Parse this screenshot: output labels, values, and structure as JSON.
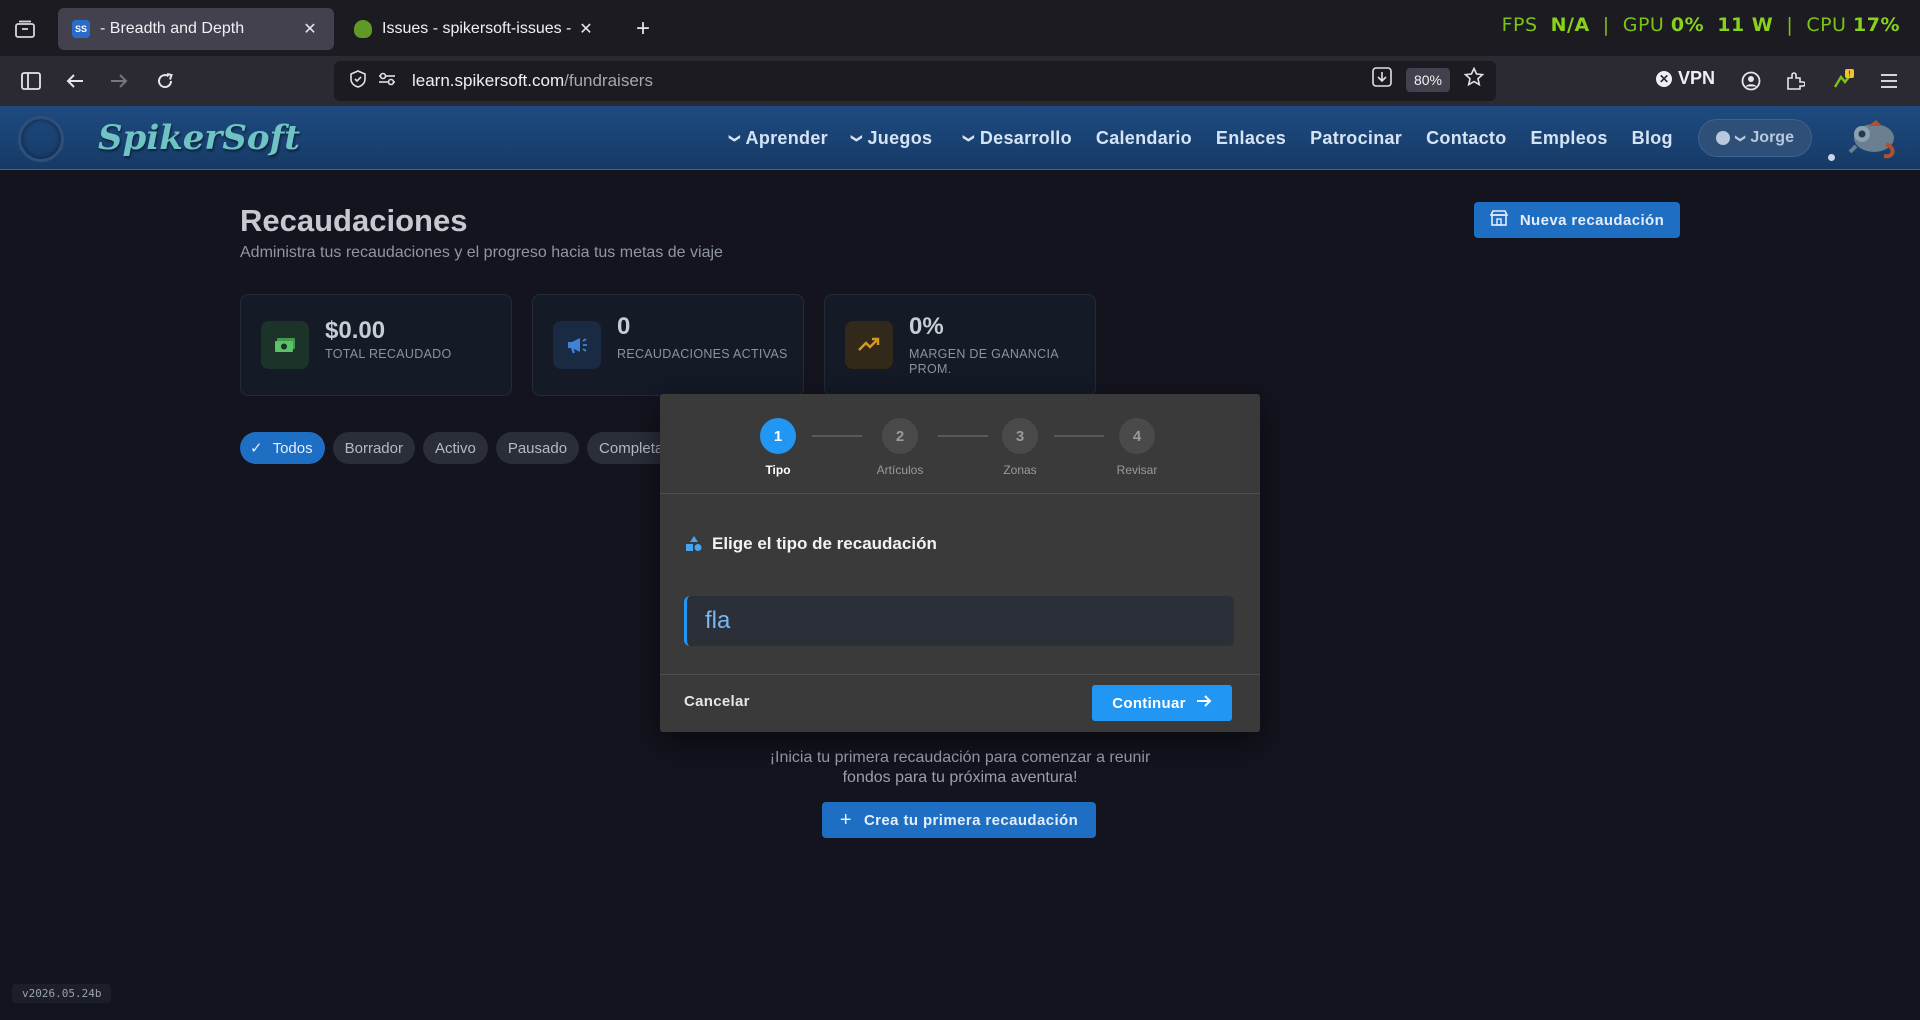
{
  "browser": {
    "tabs": [
      {
        "title": "- Breadth and Depth",
        "active": true
      },
      {
        "title": "Issues - spikersoft-issues - Gitea",
        "active": false
      }
    ],
    "url_host": "learn.spikersoft.com",
    "url_path": "/fundraisers",
    "zoom": "80%",
    "vpn_label": "VPN",
    "perf_overlay": {
      "fps_label": "FPS",
      "fps_value": "N/A",
      "gpu_label": "GPU",
      "gpu_value": "0%",
      "power": "11 W",
      "cpu_label": "CPU",
      "cpu_value": "17%"
    }
  },
  "site": {
    "logo": "SpikerSoft",
    "nav": [
      {
        "label": "Aprender",
        "dropdown": true
      },
      {
        "label": "Juegos",
        "dropdown": true
      },
      {
        "label": "Desarrollo",
        "dropdown": true
      },
      {
        "label": "Calendario",
        "dropdown": false
      },
      {
        "label": "Enlaces",
        "dropdown": false
      },
      {
        "label": "Patrocinar",
        "dropdown": false
      },
      {
        "label": "Contacto",
        "dropdown": false
      },
      {
        "label": "Empleos",
        "dropdown": false
      },
      {
        "label": "Blog",
        "dropdown": false
      }
    ],
    "user": "Jorge"
  },
  "page": {
    "title": "Recaudaciones",
    "subtitle": "Administra tus recaudaciones y el progreso hacia tus metas de viaje",
    "new_button": "Nueva recaudación",
    "stats": [
      {
        "value": "$0.00",
        "label": "TOTAL RECAUDADO",
        "icon": "money-icon",
        "color": "#3f9a4a"
      },
      {
        "value": "0",
        "label": "RECAUDACIONES ACTIVAS",
        "icon": "megaphone-icon",
        "color": "#3f82d6"
      },
      {
        "value": "0%",
        "label": "MARGEN DE GANANCIA PROM.",
        "icon": "trending-up-icon",
        "color": "#d49a1e"
      }
    ],
    "filters": [
      "Todos",
      "Borrador",
      "Activo",
      "Pausado",
      "Completado"
    ],
    "empty_text": "¡Inicia tu primera recaudación para comenzar a reunir fondos para tu próxima aventura!",
    "create_button": "Crea tu primera recaudación",
    "version": "v2026.05.24b"
  },
  "modal": {
    "steps": [
      {
        "number": "1",
        "label": "Tipo",
        "active": true
      },
      {
        "number": "2",
        "label": "Artículos",
        "active": false
      },
      {
        "number": "3",
        "label": "Zonas",
        "active": false
      },
      {
        "number": "4",
        "label": "Revisar",
        "active": false
      }
    ],
    "heading": "Elige el tipo de recaudación",
    "input_value": "fla",
    "cancel": "Cancelar",
    "continue": "Continuar"
  },
  "colors": {
    "accent": "#2196f3",
    "site_primary": "#1e6fc4",
    "perf_green": "#7cc316"
  }
}
